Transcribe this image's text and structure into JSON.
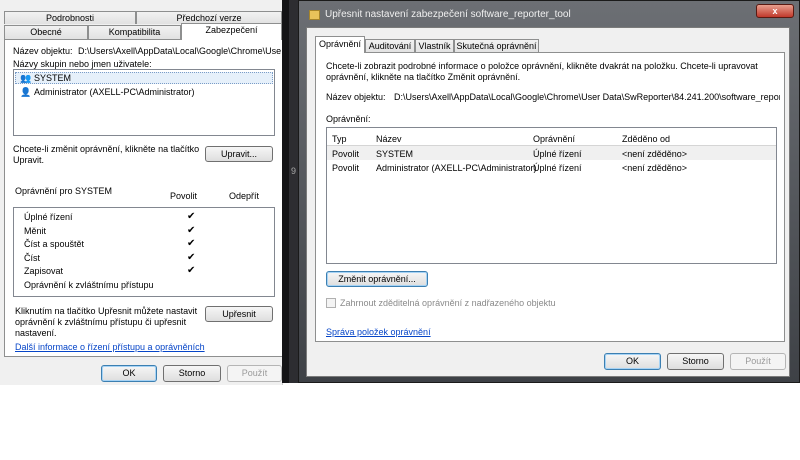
{
  "left": {
    "tabs_row1": [
      "Podrobnosti",
      "Předchozí verze"
    ],
    "tabs_row2": [
      "Obecné",
      "Kompatibilita",
      "Zabezpečení"
    ],
    "object_name_label": "Název objektu:",
    "object_name_value": "D:\\Users\\Axell\\AppData\\Local\\Google\\Chrome\\Use",
    "groups_label": "Názvy skupin nebo jmen uživatele:",
    "users": [
      "SYSTEM",
      "Administrator (AXELL-PC\\Administrator)"
    ],
    "change_hint": "Chcete-li změnit oprávnění, klikněte na tlačítko Upravit.",
    "edit_button": "Upravit...",
    "perm_for": "Oprávnění pro SYSTEM",
    "col_allow": "Povolit",
    "col_deny": "Odepřít",
    "permissions": [
      {
        "name": "Úplné řízení",
        "allow": "✔"
      },
      {
        "name": "Měnit",
        "allow": "✔"
      },
      {
        "name": "Číst a spouštět",
        "allow": "✔"
      },
      {
        "name": "Číst",
        "allow": "✔"
      },
      {
        "name": "Zapisovat",
        "allow": "✔"
      },
      {
        "name": "Oprávnění k zvláštnímu přístupu",
        "allow": ""
      }
    ],
    "advanced_hint": "Kliknutím na tlačítko Upřesnit můžete nastavit oprávnění k zvláštnímu přístupu či upřesnit nastavení.",
    "advanced_button": "Upřesnit",
    "more_info_link": "Další informace o řízení přístupu a oprávněních",
    "ok": "OK",
    "cancel": "Storno",
    "apply": "Použít"
  },
  "right": {
    "title": "Upřesnit nastavení zabezpečení software_reporter_tool",
    "close_glyph": "x",
    "tabs": [
      "Oprávnění",
      "Auditování",
      "Vlastník",
      "Skutečná oprávnění"
    ],
    "intro": "Chcete-li zobrazit podrobné informace o položce oprávnění, klikněte dvakrát na položku. Chcete-li upravovat oprávnění, klikněte na tlačítko Změnit oprávnění.",
    "object_name_label": "Název objektu:",
    "object_name_value": "D:\\Users\\Axell\\AppData\\Local\\Google\\Chrome\\User Data\\SwReporter\\84.241.200\\software_reporter_t",
    "permissions_label": "Oprávnění:",
    "columns": [
      "Typ",
      "Název",
      "Oprávnění",
      "Zděděno od"
    ],
    "rows": [
      [
        "Povolit",
        "SYSTEM",
        "Úplné řízení",
        "<není zděděno>"
      ],
      [
        "Povolit",
        "Administrator (AXELL-PC\\Administrator)",
        "Úplné řízení",
        "<není zděděno>"
      ]
    ],
    "change_button": "Změnit oprávnění...",
    "inherit_checkbox": "Zahrnout zděditelná oprávnění z nadřazeného objektu",
    "manage_link": "Správa položek oprávnění",
    "ok": "OK",
    "cancel": "Storno",
    "apply": "Použít"
  },
  "side_char": "9"
}
